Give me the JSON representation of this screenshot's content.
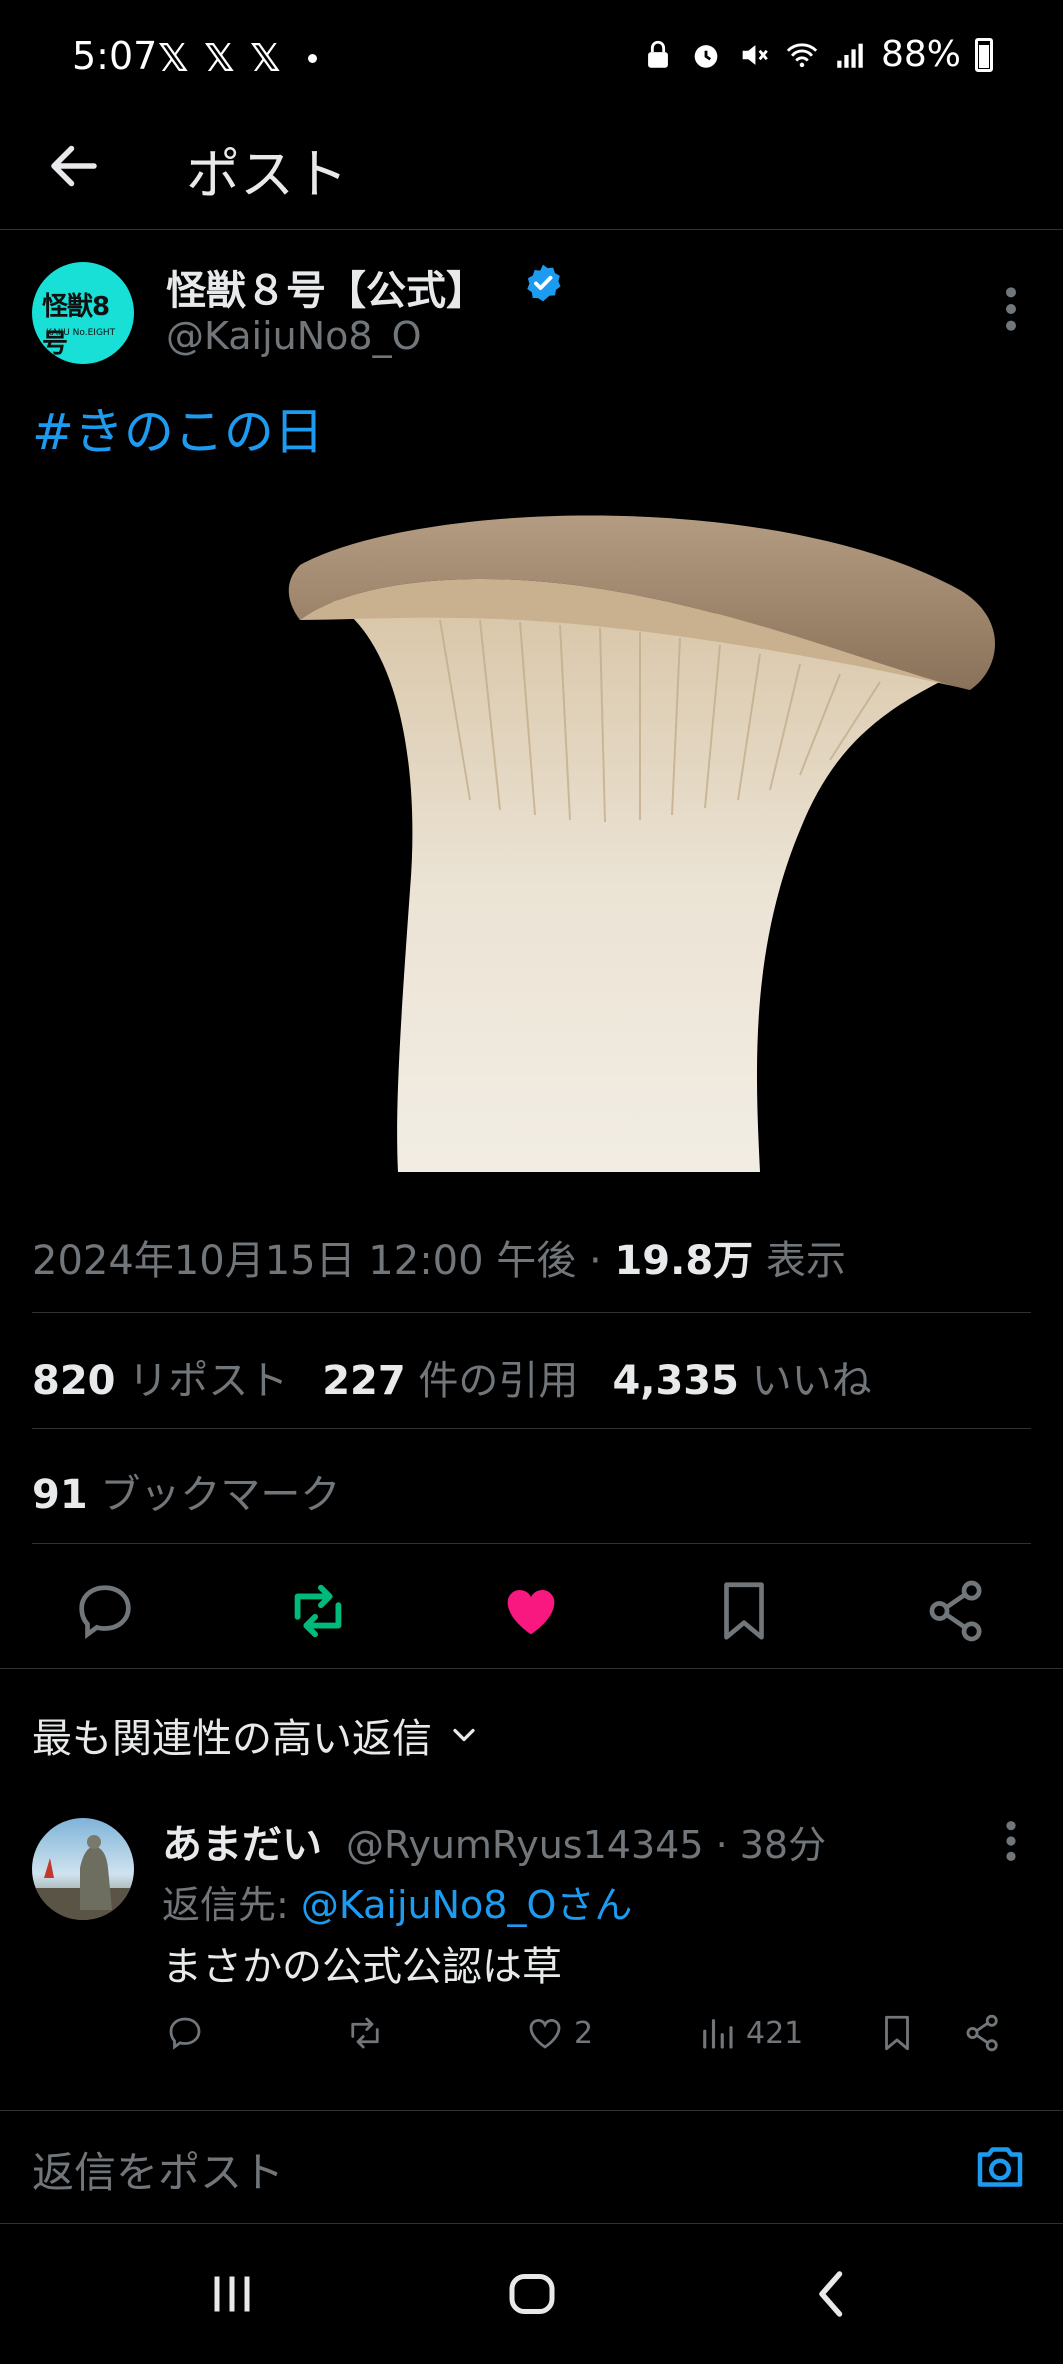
{
  "status_bar": {
    "time": "5:07",
    "x_icons": [
      "𝕏",
      "𝕏",
      "𝕏"
    ],
    "battery": "88%"
  },
  "header": {
    "title": "ポスト"
  },
  "post": {
    "author_name": "怪獣８号【公式】",
    "author_handle": "@KaijuNo8_O",
    "avatar_logo": "怪獣8号",
    "avatar_sub": "KAIJU No.EIGHT",
    "text": "#きのこの日",
    "datetime": "2024年10月15日 12:00 午後 · ",
    "views_num": "19.8万",
    "views_label": " 表示",
    "reposts_num": "820",
    "reposts_label": " リポスト",
    "quotes_num": "227",
    "quotes_label": " 件の引用",
    "likes_num": "4,335",
    "likes_label": " いいね",
    "bookmarks_num": "91",
    "bookmarks_label": " ブックマーク"
  },
  "relevance": {
    "label": "最も関連性の高い返信"
  },
  "reply": {
    "name": "あまだい",
    "handle": "@RyumRyus14345 · 38分",
    "reply_to_prefix": "返信先: ",
    "reply_to_link": "@KaijuNo8_Oさん",
    "text": "まさかの公式公認は草",
    "likes": "2",
    "views": "421"
  },
  "compose": {
    "placeholder": "返信をポスト"
  },
  "colors": {
    "accent": "#1d9bf0",
    "like": "#f91880",
    "repost": "#00ba7c",
    "muted": "#71767b",
    "avatar_bg": "#18e0d6"
  }
}
